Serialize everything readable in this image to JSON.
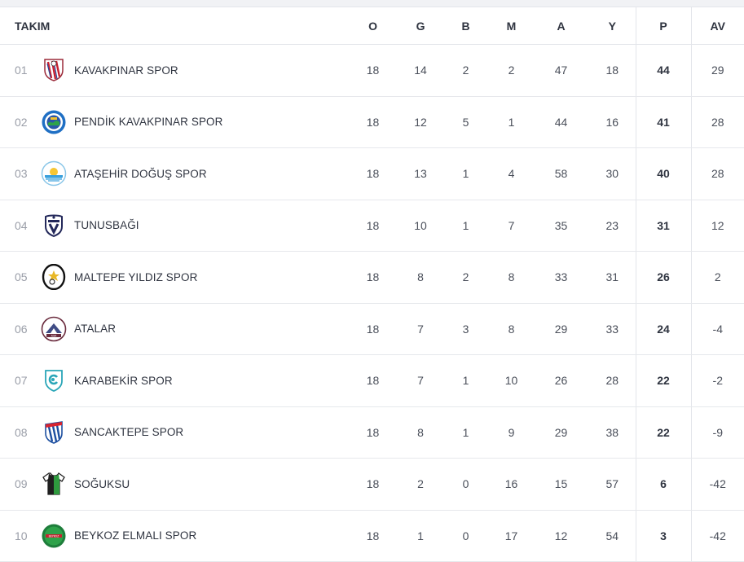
{
  "headers": {
    "team": "TAKIM",
    "o": "O",
    "g": "G",
    "b": "B",
    "m": "M",
    "a": "A",
    "y": "Y",
    "p": "P",
    "av": "AV"
  },
  "rows": [
    {
      "rank": "01",
      "team": "KAVAKPINAR SPOR",
      "logo": "kavakpinar-crest-icon",
      "o": "18",
      "g": "14",
      "b": "2",
      "m": "2",
      "a": "47",
      "y": "18",
      "p": "44",
      "av": "29"
    },
    {
      "rank": "02",
      "team": "PENDİK KAVAKPINAR SPOR",
      "logo": "pendik-kavakpinar-crest-icon",
      "o": "18",
      "g": "12",
      "b": "5",
      "m": "1",
      "a": "44",
      "y": "16",
      "p": "41",
      "av": "28"
    },
    {
      "rank": "03",
      "team": "ATAŞEHİR DOĞUŞ SPOR",
      "logo": "atasehir-dogus-crest-icon",
      "o": "18",
      "g": "13",
      "b": "1",
      "m": "4",
      "a": "58",
      "y": "30",
      "p": "40",
      "av": "28"
    },
    {
      "rank": "04",
      "team": "TUNUSBAĞI",
      "logo": "tunusbagi-crest-icon",
      "o": "18",
      "g": "10",
      "b": "1",
      "m": "7",
      "a": "35",
      "y": "23",
      "p": "31",
      "av": "12"
    },
    {
      "rank": "05",
      "team": "MALTEPE YILDIZ SPOR",
      "logo": "maltepe-yildiz-crest-icon",
      "o": "18",
      "g": "8",
      "b": "2",
      "m": "8",
      "a": "33",
      "y": "31",
      "p": "26",
      "av": "2"
    },
    {
      "rank": "06",
      "team": "ATALAR",
      "logo": "atalar-crest-icon",
      "o": "18",
      "g": "7",
      "b": "3",
      "m": "8",
      "a": "29",
      "y": "33",
      "p": "24",
      "av": "-4"
    },
    {
      "rank": "07",
      "team": "KARABEKİR SPOR",
      "logo": "karabekir-crest-icon",
      "o": "18",
      "g": "7",
      "b": "1",
      "m": "10",
      "a": "26",
      "y": "28",
      "p": "22",
      "av": "-2"
    },
    {
      "rank": "08",
      "team": "SANCAKTEPE SPOR",
      "logo": "sancaktepe-crest-icon",
      "o": "18",
      "g": "8",
      "b": "1",
      "m": "9",
      "a": "29",
      "y": "38",
      "p": "22",
      "av": "-9"
    },
    {
      "rank": "09",
      "team": "SOĞUKSU",
      "logo": "soguksu-jersey-icon",
      "o": "18",
      "g": "2",
      "b": "0",
      "m": "16",
      "a": "15",
      "y": "57",
      "p": "6",
      "av": "-42"
    },
    {
      "rank": "10",
      "team": "BEYKOZ ELMALI SPOR",
      "logo": "beykoz-elmali-crest-icon",
      "o": "18",
      "g": "1",
      "b": "0",
      "m": "17",
      "a": "12",
      "y": "54",
      "p": "3",
      "av": "-42"
    }
  ],
  "logo_svgs": {
    "kavakpinar-crest-icon": "<svg viewBox='0 0 32 32' width='32' height='32'><path d='M5 3h22v13c0 7-5 11-11 13C10 27 5 23 5 16z' fill='#fff' stroke='#9b2b3a' stroke-width='1.5'/><path d='M9 6l4 20M14 5l4 22M19 5l4 19' stroke='#c8202f' stroke-width='2.4'/><path d='M8 8l4 17M16 5l4 22' stroke='#2b4a9c' stroke-width='1.2'/><circle cx='16' cy='8' r='3' fill='#fff' stroke='#333' stroke-width='.8'/></svg>",
    "pendik-kavakpinar-crest-icon": "<svg viewBox='0 0 32 32' width='32' height='32'><circle cx='16' cy='16' r='14.5' fill='#1f6fc4'/><circle cx='16' cy='16' r='11' fill='#fff'/><circle cx='16' cy='16' r='8.5' fill='#2a57a8'/><path d='M9 17c3-3 5 1 7-1s4-3 7 0v4H9z' fill='#2ea24a'/><rect x='12' y='10' width='8' height='3' fill='#f2c12e'/></svg>",
    "atasehir-dogus-crest-icon": "<svg viewBox='0 0 32 32' width='32' height='32'><circle cx='16' cy='16' r='14.5' fill='#fff' stroke='#8ac6e8' stroke-width='1.5'/><circle cx='16' cy='14' r='5' fill='#f6c633'/><path d='M5 18h22v3H5z' fill='#3aa0dc'/><path d='M6 21h20v3H6z' fill='#7fc3ea'/><path d='M9 25h14' stroke='#3aa0dc' stroke-width='1.2'/></svg>",
    "tunusbagi-crest-icon": "<svg viewBox='0 0 32 32' width='32' height='32'><path d='M6 5c4-2 16-2 20 0v12c0 7-5 10-10 12-5-2-10-5-10-12z' fill='#fff' stroke='#23285a' stroke-width='2'/><path d='M9 9h14v3H9z' fill='#23285a'/><path d='M11 14l5 10 5-10' fill='none' stroke='#23285a' stroke-width='3'/><circle cx='16' cy='6' r='1.6' fill='#23285a'/></svg>",
    "maltepe-yildiz-crest-icon": "<svg viewBox='0 0 32 32' width='32' height='32'><ellipse cx='16' cy='16' rx='13' ry='15' fill='#fff' stroke='#111' stroke-width='2.4'/><path d='M16 8l2 5h5l-4 3 2 5-5-3-5 3 2-5-4-3h5z' fill='#e9b826'/><circle cx='14' cy='22' r='3' fill='#fff' stroke='#111'/></svg>",
    "atalar-crest-icon": "<svg viewBox='0 0 32 32' width='32' height='32'><circle cx='16' cy='16' r='14.5' fill='#fff' stroke='#6b2c3e' stroke-width='1.6'/><path d='M6 21l10-12 10 12z' fill='#3f4c85'/><path d='M12 21l4-6 4 6z' fill='#fff'/><rect x='7' y='22' width='18' height='4' fill='#6b2c3e'/><text x='16' y='25.3' font-size='3.4' fill='#fff' text-anchor='middle' font-family='DejaVu Sans'>ASK</text></svg>",
    "karabekir-crest-icon": "<svg viewBox='0 0 32 32' width='32' height='32'><path d='M6 4h20v13c0 6-5 10-10 12C11 27 6 23 6 17z' fill='#fff' stroke='#2aa6b8' stroke-width='1.8'/><path d='M20 12a5 5 0 1 0 0 6' fill='none' stroke='#2aa6b8' stroke-width='2.6'/><circle cx='15' cy='15' r='2' fill='#2aa6b8'/></svg>",
    "sancaktepe-crest-icon": "<svg viewBox='0 0 32 32' width='32' height='32'><path d='M6 6l20-3v14c0 7-5 10-10 12C11 27 6 24 6 17z' fill='#fff' stroke='#1d4fa0' stroke-width='1.6'/><path d='M10 9l4 18M15 8l4 19M20 7l3 17' stroke='#1d4fa0' stroke-width='2.4'/><path d='M6 6l20-3v4L6 10z' fill='#d8232f'/></svg>",
    "soguksu-jersey-icon": "<svg viewBox='0 0 32 32' width='32' height='32'><path d='M10 3l-7 5 3 5 3-2v18h14V11l3 2 3-5-7-5c-1 2-3 3-5 3s-4-1-5-3z' fill='#fff' stroke='#222' stroke-width='1.3'/><path d='M9 11v18h7V6c-2 0-5-1-6-3z' fill='#1f1f1f'/><path d='M16 6v23h7V11l-1-7c-1 2-3 2-6 2z' fill='#2e9a3e'/></svg>",
    "beykoz-elmali-crest-icon": "<svg viewBox='0 0 32 32' width='32' height='32'><circle cx='16' cy='16' r='14.5' fill='#1e7d3b'/><circle cx='16' cy='16' r='11.5' fill='#2ea24a'/><rect x='6' y='14' width='20' height='4' fill='#c8202f'/><text x='16' y='17.3' font-size='3.2' fill='#fff' text-anchor='middle' font-family='DejaVu Sans'>BEYKOZ</text></svg>"
  },
  "colors": {
    "header_text": "#2f3440",
    "rank_text": "#9a9ea8",
    "divider": "#e3e5ea"
  }
}
